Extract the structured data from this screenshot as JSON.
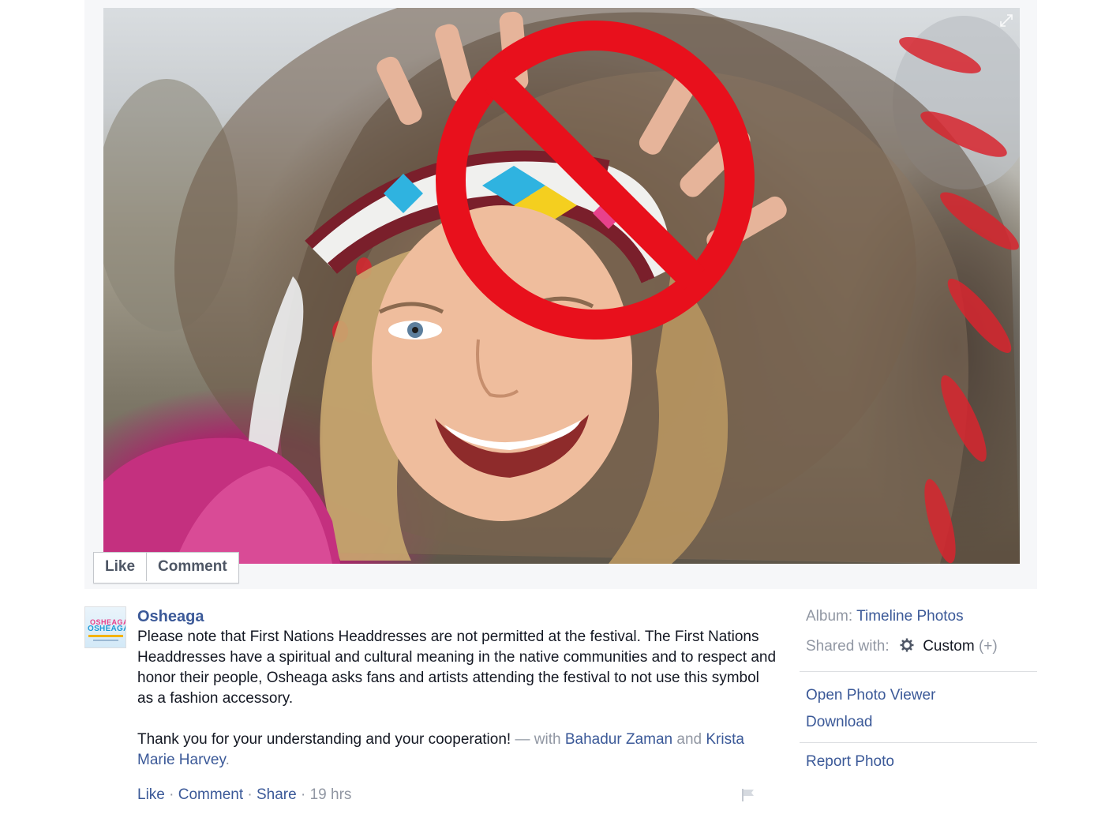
{
  "photo_actions": {
    "like": "Like",
    "comment": "Comment"
  },
  "post": {
    "author": "Osheaga",
    "paragraph1": "Please note that First Nations Headdresses are not permitted at the festival. The First Nations Headdresses have a spiritual and cultural meaning in the native communities and to respect and honor their people, Osheaga asks fans and artists attending the festival to not use this symbol as a fashion accessory.",
    "paragraph2": "Thank you for your understanding and your cooperation!",
    "with_prefix": "— with",
    "tagged": [
      "Bahadur Zaman",
      "Krista Marie Harvey"
    ],
    "and": "and",
    "period": ".",
    "footer": {
      "like": "Like",
      "comment": "Comment",
      "share": "Share",
      "separator": "·",
      "time": "19 hrs"
    }
  },
  "avatar_logo": {
    "line1": "OSHEAGA",
    "line2": "OSHEAGA"
  },
  "side": {
    "album_label": "Album:",
    "album_value": "Timeline Photos",
    "shared_label": "Shared with:",
    "shared_value": "Custom",
    "shared_extra": "(+)",
    "open_viewer": "Open Photo Viewer",
    "download": "Download",
    "report": "Report Photo"
  },
  "icons": {
    "expand": "expand-arrows-icon",
    "gear": "gear-icon",
    "flag": "flag-icon",
    "prohibit": "prohibition-sign"
  },
  "colors": {
    "link": "#3b5998",
    "muted": "#9197a3",
    "prohibit_red": "#e8101c",
    "stage_bg": "#f6f7f9"
  }
}
